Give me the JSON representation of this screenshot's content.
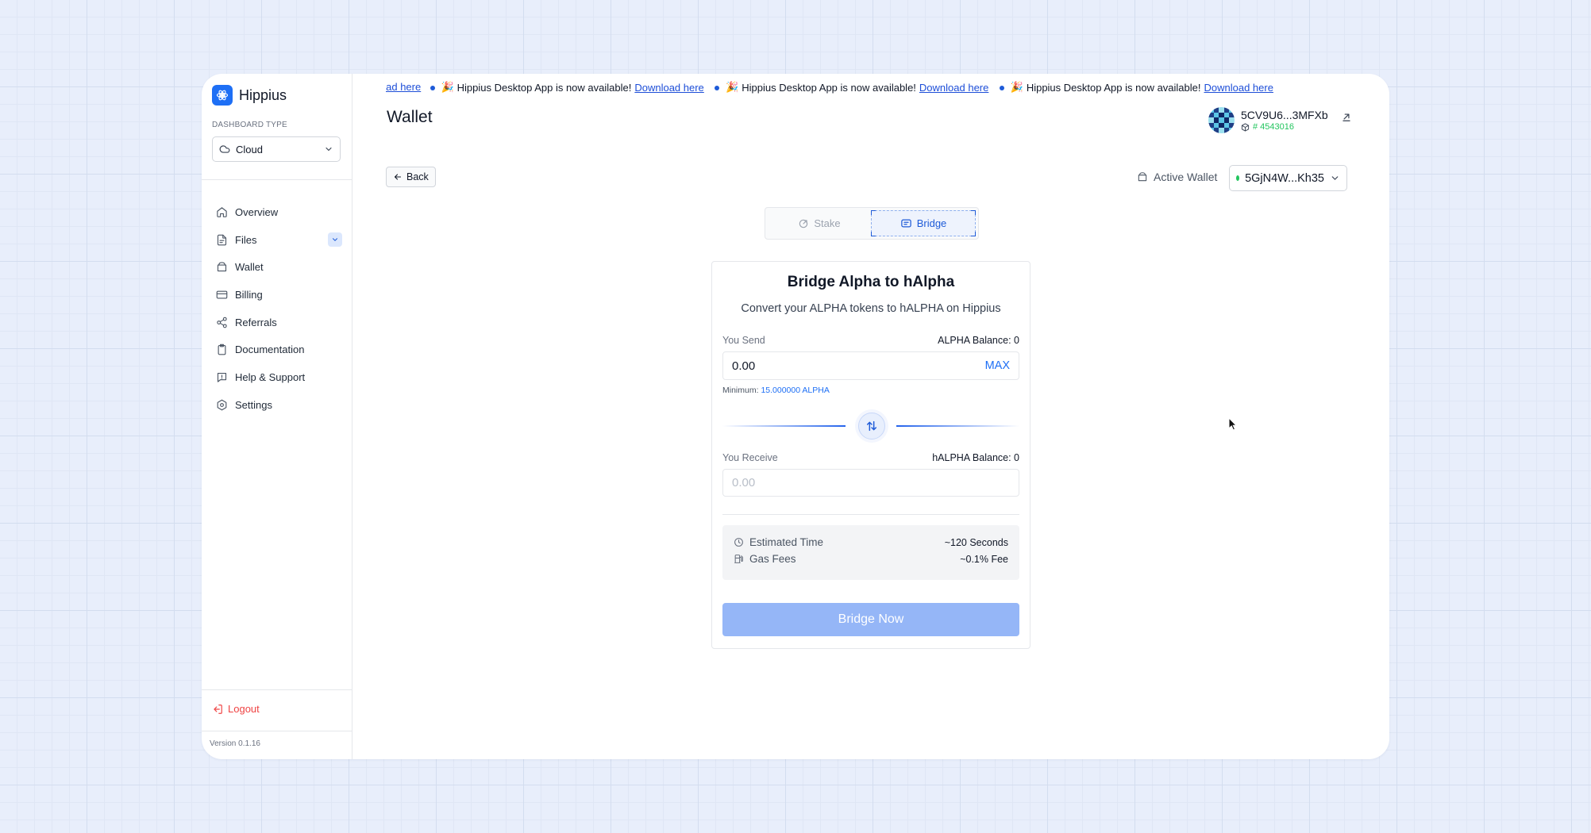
{
  "sidebar": {
    "brand": "Hippius",
    "dashboard_type_label": "DASHBOARD TYPE",
    "dashboard_type_value": "Cloud",
    "nav": [
      {
        "label": "Overview",
        "icon": "home-icon"
      },
      {
        "label": "Files",
        "icon": "file-icon"
      },
      {
        "label": "Wallet",
        "icon": "wallet-icon"
      },
      {
        "label": "Billing",
        "icon": "credit-card-icon"
      },
      {
        "label": "Referrals",
        "icon": "share-icon"
      },
      {
        "label": "Documentation",
        "icon": "clipboard-icon"
      },
      {
        "label": "Help & Support",
        "icon": "help-icon"
      },
      {
        "label": "Settings",
        "icon": "settings-icon"
      }
    ],
    "logout": "Logout",
    "version": "Version 0.1.16"
  },
  "banner": {
    "lead_link": "load here",
    "message": "Hippius Desktop App is now available!",
    "link": "Download here",
    "emoji": "🎉"
  },
  "header": {
    "title": "Wallet",
    "account_address": "5CV9U6...3MFXb",
    "block_number": "# 4543016"
  },
  "toolbar": {
    "back_label": "Back",
    "active_wallet_label": "Active Wallet",
    "active_wallet_value": "5GjN4W...Kh35"
  },
  "tabs": [
    {
      "label": "Stake",
      "active": false
    },
    {
      "label": "Bridge",
      "active": true
    }
  ],
  "bridge": {
    "title": "Bridge Alpha to hAlpha",
    "subtitle": "Convert your ALPHA tokens to hALPHA on Hippius",
    "send_label": "You Send",
    "send_balance": "ALPHA Balance: 0",
    "send_value": "0.00",
    "max_label": "MAX",
    "minimum_label": "Minimum:",
    "minimum_value": "15.000000 ALPHA",
    "receive_label": "You Receive",
    "receive_balance": "hALPHA Balance: 0",
    "receive_placeholder": "0.00",
    "estimated_time_label": "Estimated Time",
    "estimated_time_value": "~120 Seconds",
    "gas_fees_label": "Gas Fees",
    "gas_fees_value": "~0.1% Fee",
    "submit_label": "Bridge Now"
  },
  "colors": {
    "accent": "#1e6ff5",
    "disabled_button": "#95b6f7",
    "logout": "#ef4444",
    "status_green": "#22c55e"
  }
}
